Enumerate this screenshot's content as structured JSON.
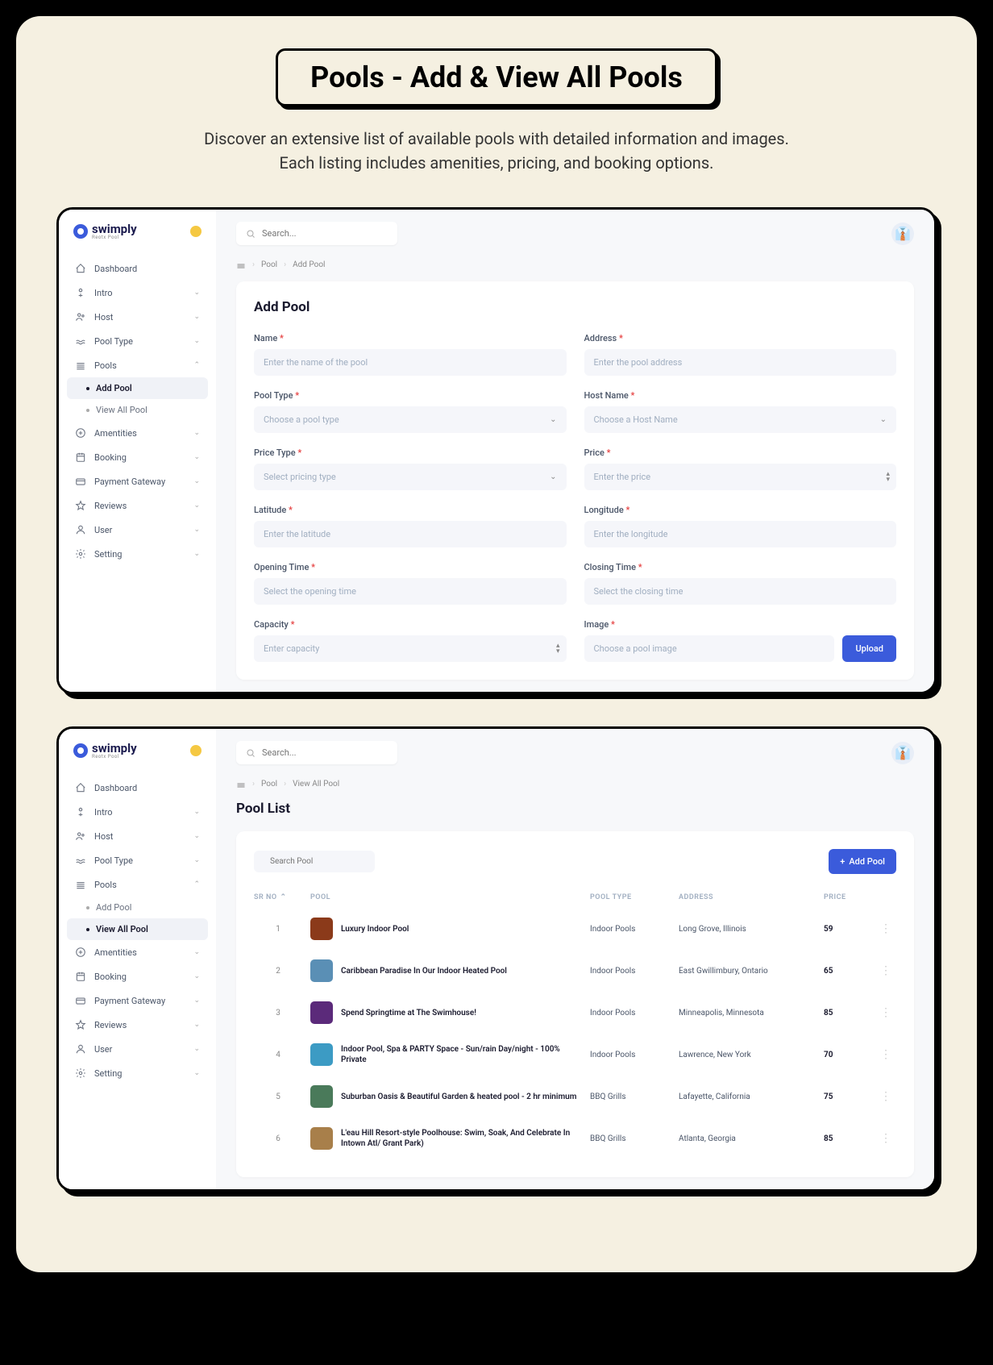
{
  "header": {
    "title": "Pools - Add & View All Pools",
    "subtitle_line1": "Discover an extensive list of available pools with detailed information and images.",
    "subtitle_line2": "Each listing includes amenities, pricing, and booking options."
  },
  "brand": {
    "name": "swimply",
    "tagline": "Reotx Pool"
  },
  "search_placeholder": "Search...",
  "sidebar": {
    "items": [
      {
        "label": "Dashboard"
      },
      {
        "label": "Intro"
      },
      {
        "label": "Host"
      },
      {
        "label": "Pool Type"
      },
      {
        "label": "Pools"
      },
      {
        "label": "Amentities"
      },
      {
        "label": "Booking"
      },
      {
        "label": "Payment Gateway"
      },
      {
        "label": "Reviews"
      },
      {
        "label": "User"
      },
      {
        "label": "Setting"
      }
    ],
    "pools_sub": [
      {
        "label": "Add Pool"
      },
      {
        "label": "View All Pool"
      }
    ]
  },
  "screen1": {
    "breadcrumb": {
      "a": "Pool",
      "b": "Add Pool"
    },
    "title": "Add Pool",
    "fields": {
      "name": {
        "label": "Name",
        "placeholder": "Enter the name of the pool"
      },
      "address": {
        "label": "Address",
        "placeholder": "Enter the pool address"
      },
      "pool_type": {
        "label": "Pool Type",
        "placeholder": "Choose a pool type"
      },
      "host_name": {
        "label": "Host Name",
        "placeholder": "Choose a Host Name"
      },
      "price_type": {
        "label": "Price Type",
        "placeholder": "Select pricing type"
      },
      "price": {
        "label": "Price",
        "placeholder": "Enter the price"
      },
      "latitude": {
        "label": "Latitude",
        "placeholder": "Enter the latitude"
      },
      "longitude": {
        "label": "Longitude",
        "placeholder": "Enter the longitude"
      },
      "opening": {
        "label": "Opening Time",
        "placeholder": "Select the opening time"
      },
      "closing": {
        "label": "Closing Time",
        "placeholder": "Select the closing time"
      },
      "capacity": {
        "label": "Capacity",
        "placeholder": "Enter capacity"
      },
      "image": {
        "label": "Image",
        "placeholder": "Choose a pool image",
        "button": "Upload"
      }
    }
  },
  "screen2": {
    "breadcrumb": {
      "a": "Pool",
      "b": "View All Pool"
    },
    "title": "Pool List",
    "search_placeholder": "Search Pool",
    "add_button": "Add Pool",
    "columns": {
      "sr": "SR NO",
      "pool": "POOL",
      "type": "POOL TYPE",
      "address": "ADDRESS",
      "price": "PRICE"
    },
    "rows": [
      {
        "sr": "1",
        "name": "Luxury Indoor Pool",
        "type": "Indoor Pools",
        "address": "Long Grove, Illinois",
        "price": "59",
        "color": "#8b3a1a"
      },
      {
        "sr": "2",
        "name": "Caribbean Paradise In Our Indoor Heated Pool",
        "type": "Indoor Pools",
        "address": "East Gwillimbury, Ontario",
        "price": "65",
        "color": "#5a8fb5"
      },
      {
        "sr": "3",
        "name": "Spend Springtime at The Swimhouse!",
        "type": "Indoor Pools",
        "address": "Minneapolis, Minnesota",
        "price": "85",
        "color": "#5b2a7a"
      },
      {
        "sr": "4",
        "name": "Indoor Pool, Spa & PARTY Space - Sun/rain Day/night - 100% Private",
        "type": "Indoor Pools",
        "address": "Lawrence, New York",
        "price": "70",
        "color": "#3c9bc4"
      },
      {
        "sr": "5",
        "name": "Suburban Oasis & Beautiful Garden & heated pool - 2 hr minimum",
        "type": "BBQ Grills",
        "address": "Lafayette, California",
        "price": "75",
        "color": "#4a7a5a"
      },
      {
        "sr": "6",
        "name": "L'eau Hill Resort-style Poolhouse: Swim, Soak, And Celebrate In Intown Atl/ Grant Park)",
        "type": "BBQ Grills",
        "address": "Atlanta, Georgia",
        "price": "85",
        "color": "#a87f4a"
      }
    ]
  }
}
